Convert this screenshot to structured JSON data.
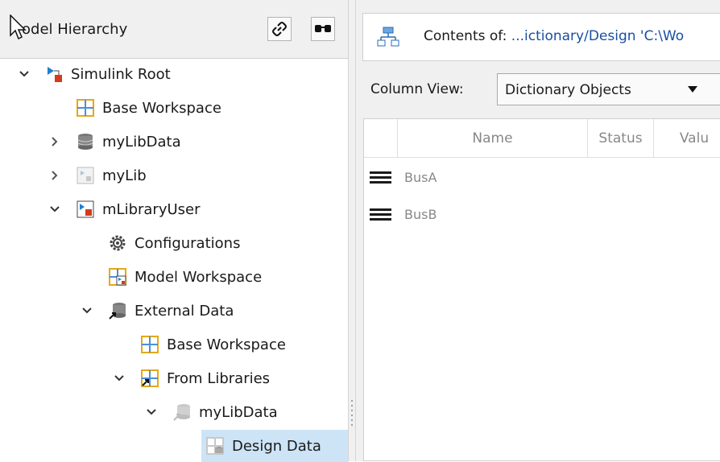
{
  "left_panel": {
    "title": "odel Hierarchy",
    "buttons": [
      {
        "name": "link-button",
        "icon": "link-icon"
      },
      {
        "name": "glasses-button",
        "icon": "glasses-icon"
      }
    ]
  },
  "tree": [
    {
      "label": "Simulink Root",
      "icon": "simulink-root-icon",
      "expanded": true
    },
    {
      "label": "Base Workspace",
      "icon": "workspace-icon"
    },
    {
      "label": "myLibData",
      "icon": "database-icon",
      "expanded": false
    },
    {
      "label": "myLib",
      "icon": "library-model-icon",
      "expanded": false
    },
    {
      "label": "mLibraryUser",
      "icon": "model-icon",
      "expanded": true
    },
    {
      "label": "Configurations",
      "icon": "gear-icon"
    },
    {
      "label": "Model Workspace",
      "icon": "model-workspace-icon"
    },
    {
      "label": "External Data",
      "icon": "external-data-icon",
      "expanded": true
    },
    {
      "label": "Base Workspace",
      "icon": "workspace-icon"
    },
    {
      "label": "From Libraries",
      "icon": "from-libraries-icon",
      "expanded": true
    },
    {
      "label": "myLibData",
      "icon": "database-icon",
      "expanded": true
    },
    {
      "label": "Design Data",
      "icon": "design-data-icon",
      "selected": true
    }
  ],
  "contents": {
    "prefix": "Contents of:",
    "path": "...ictionary/Design 'C:\\Wo"
  },
  "column_view": {
    "label": "Column View:",
    "selected": "Dictionary Objects"
  },
  "grid": {
    "columns": [
      "Name",
      "Status",
      "Valu"
    ],
    "rows": [
      "BusA",
      "BusB"
    ]
  },
  "colors": {
    "selection": "#cde4f7",
    "panel_bg": "#f0f0f0",
    "link_text": "#1a4fa0"
  }
}
